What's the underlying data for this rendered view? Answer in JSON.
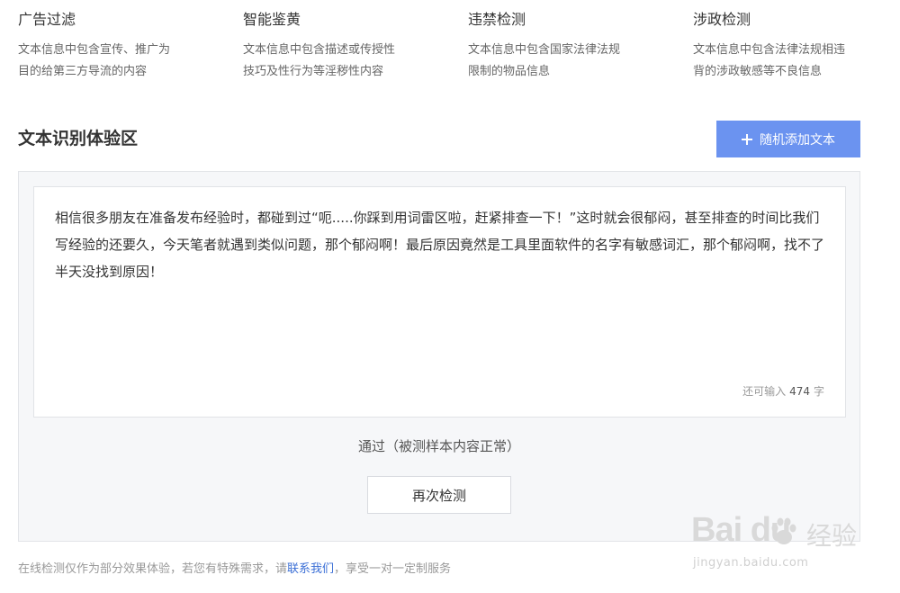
{
  "features": [
    {
      "title": "广告过滤",
      "desc": "文本信息中包含宣传、推广为\n目的给第三方导流的内容"
    },
    {
      "title": "智能鉴黄",
      "desc": "文本信息中包含描述或传授性\n技巧及性行为等淫秽性内容"
    },
    {
      "title": "违禁检测",
      "desc": "文本信息中包含国家法律法规\n限制的物品信息"
    },
    {
      "title": "涉政检测",
      "desc": "文本信息中包含法律法规相违\n背的涉政敏感等不良信息"
    }
  ],
  "section": {
    "title": "文本识别体验区",
    "add_button_label": "随机添加文本"
  },
  "textbox": {
    "content": "相信很多朋友在准备发布经验时，都碰到过“呃.....你踩到用词雷区啦，赶紧排查一下！”这时就会很郁闷，甚至排查的时间比我们写经验的还要久，今天笔者就遇到类似问题，那个郁闷啊！最后原因竟然是工具里面软件的名字有敏感词汇，那个郁闷啊，找不了半天没找到原因！",
    "counter_prefix": "还可输入",
    "counter_remaining": "474",
    "counter_suffix": "字"
  },
  "result": {
    "text": "通过（被测样本内容正常）",
    "recheck_label": "再次检测"
  },
  "footer": {
    "prefix": "在线检测仅作为部分效果体验，若您有特殊需求，请",
    "link": "联系我们",
    "suffix": "，享受一对一定制服务"
  },
  "watermark": {
    "brand": "Bai  du",
    "cn": "经验",
    "url": "jingyan.baidu.com"
  },
  "colors": {
    "accent": "#6b93f0",
    "link": "#3b6fd6",
    "panel_bg": "#f6f7f9"
  }
}
